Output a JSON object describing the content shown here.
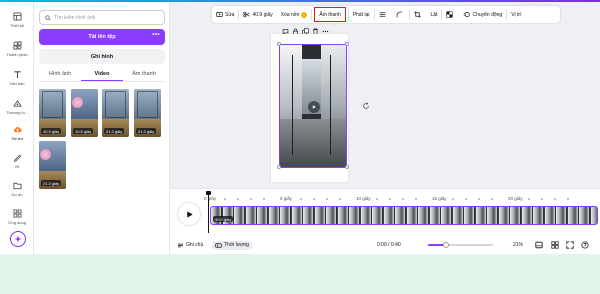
{
  "rail": {
    "items": [
      {
        "label": "Thiết kế",
        "icon": "layout-icon"
      },
      {
        "label": "Thành phần",
        "icon": "elements-icon"
      },
      {
        "label": "Văn bản",
        "icon": "text-icon"
      },
      {
        "label": "Thương hi...",
        "icon": "brand-icon"
      },
      {
        "label": "Tải lên",
        "icon": "upload-cloud-icon"
      },
      {
        "label": "Vẽ",
        "icon": "draw-icon"
      },
      {
        "label": "Dự án",
        "icon": "folder-icon"
      },
      {
        "label": "Ứng dụng",
        "icon": "apps-icon"
      }
    ],
    "active_index": 4,
    "accent_color": "#8b3dff"
  },
  "panel": {
    "search_placeholder": "Tìm kiếm hình ảnh",
    "upload_label": "Tải lên tệp",
    "upload_more": "•••",
    "record_label": "Ghi hình",
    "tabs": [
      "Hình ảnh",
      "Video",
      "Âm thanh"
    ],
    "active_tab": "Video",
    "videos": [
      {
        "duration": "40.9 giây",
        "style": "plain"
      },
      {
        "duration": "10.5 giây",
        "style": "pink"
      },
      {
        "duration": "21.3 giây",
        "style": "plain"
      },
      {
        "duration": "21.3 giây",
        "style": "plain"
      },
      {
        "duration": "21.3 giây",
        "style": "pink"
      }
    ]
  },
  "toolbar": {
    "edit_label": "Sửa",
    "duration_label": "40.9 giây",
    "remove_bg_label": "Xóa nền",
    "audio_label": "Âm thanh",
    "playback_label": "Phát lại",
    "flip_label": "Lật",
    "animate_label": "Chuyển động",
    "position_label": "Vị trí",
    "highlight_color": "#e01919"
  },
  "timeline": {
    "ruler": [
      "0 giây",
      "5 giây",
      "10 giây",
      "15 giây",
      "20 giây"
    ],
    "clip_label": "40.9 giây"
  },
  "bottombar": {
    "notes_label": "Ghi chú",
    "duration_label": "Thời lượng",
    "time_readout": "0:00 / 0:40",
    "zoom_percent": "21%",
    "zoom_fraction": 0.28
  }
}
